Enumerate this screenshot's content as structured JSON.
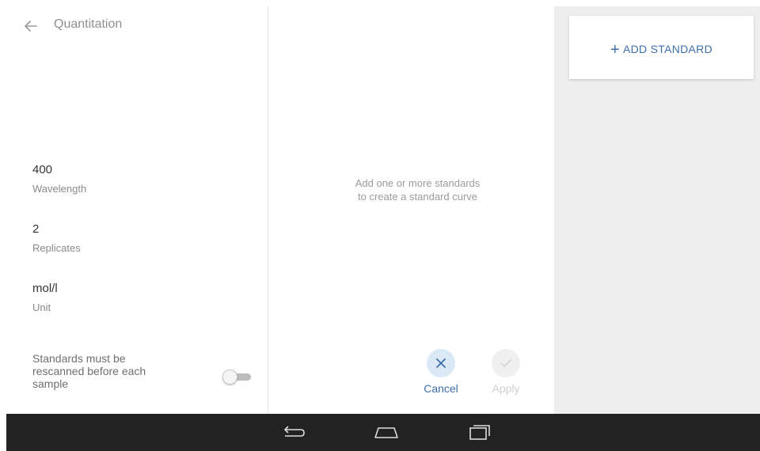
{
  "header": {
    "title": "Quantitation",
    "back_icon": "arrow-back-icon"
  },
  "settings": {
    "wavelength": {
      "value": "400",
      "label": "Wavelength"
    },
    "replicates": {
      "value": "2",
      "label": "Replicates"
    },
    "unit": {
      "value": "mol/l",
      "label": "Unit"
    },
    "rescan": {
      "line1": "Standards must be",
      "line2": "rescanned before each",
      "line3": "sample",
      "enabled": false
    }
  },
  "center": {
    "empty_line1": "Add one or more standards",
    "empty_line2": "to create a standard curve"
  },
  "actions": {
    "cancel_label": "Cancel",
    "cancel_icon": "close-icon",
    "apply_label": "Apply",
    "apply_icon": "check-icon",
    "apply_enabled": false
  },
  "standards": {
    "add_label": "ADD STANDARD",
    "add_icon": "plus-icon"
  },
  "navbar": {
    "back_icon": "nav-back-icon",
    "home_icon": "nav-home-icon",
    "recent_icon": "nav-recent-apps-icon"
  },
  "colors": {
    "accent": "#3f6fa8",
    "cancel_bg": "#dbe8f6",
    "right_panel_bg": "#eeeeee",
    "navbar_bg": "#222222"
  }
}
